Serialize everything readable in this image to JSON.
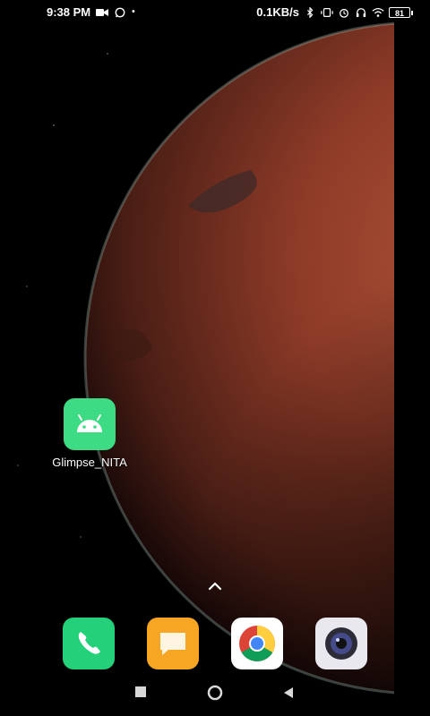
{
  "status_bar": {
    "time": "9:38 PM",
    "net_speed": "0.1KB/s",
    "battery": "81",
    "left_icons": [
      "video-icon",
      "whatsapp-icon",
      "dot-icon"
    ],
    "right_icons": [
      "bluetooth-icon",
      "vibrate-icon",
      "alarm-icon",
      "headset-icon",
      "wifi-icon",
      "battery-icon"
    ]
  },
  "home": {
    "apps": [
      {
        "label": "Glimpse_NITA",
        "icon": "android-icon",
        "color": "#3ddc84"
      }
    ]
  },
  "dock": [
    {
      "name": "phone",
      "icon": "phone-icon",
      "color": "#25d07a"
    },
    {
      "name": "messaging",
      "icon": "message-icon",
      "color": "#f6a623"
    },
    {
      "name": "chrome",
      "icon": "chrome-icon",
      "color": "#ffffff"
    },
    {
      "name": "camera",
      "icon": "camera-icon",
      "color": "#e8e8ee"
    }
  ],
  "nav_bar": [
    "recents-icon",
    "home-icon",
    "back-icon"
  ]
}
